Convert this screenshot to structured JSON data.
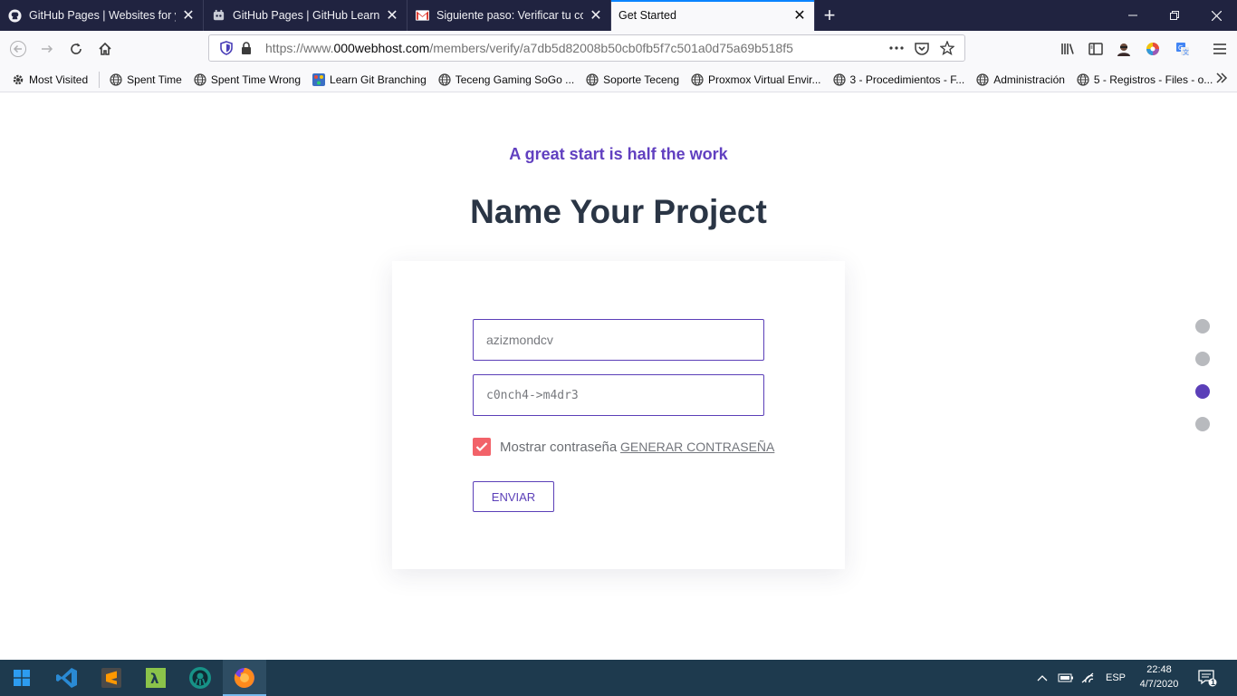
{
  "browser": {
    "tabs": [
      {
        "title": "GitHub Pages | Websites for you",
        "icon": "github-icon"
      },
      {
        "title": "GitHub Pages | GitHub Learning",
        "icon": "github-lab-icon"
      },
      {
        "title": "Siguiente paso: Verificar tu corr",
        "icon": "gmail-icon"
      },
      {
        "title": "Get Started",
        "icon": "none",
        "active": true
      }
    ],
    "url_prefix": "https://www.",
    "url_domain": "000webhost.com",
    "url_path": "/members/verify/a7db5d82008b50cb0fb5f7c501a0d75a69b518f5",
    "bookmarks": [
      {
        "label": "Most Visited",
        "icon": "gear-icon"
      },
      {
        "label": "Spent Time",
        "icon": "globe-icon"
      },
      {
        "label": "Spent Time Wrong",
        "icon": "globe-icon"
      },
      {
        "label": "Learn Git Branching",
        "icon": "git-branch-icon"
      },
      {
        "label": "Teceng Gaming SoGo ...",
        "icon": "globe-icon"
      },
      {
        "label": "Soporte Teceng",
        "icon": "globe-icon"
      },
      {
        "label": "Proxmox Virtual Envir...",
        "icon": "globe-icon"
      },
      {
        "label": "3 - Procedimientos - F...",
        "icon": "globe-icon"
      },
      {
        "label": "Administración",
        "icon": "globe-icon"
      },
      {
        "label": "5 - Registros - Files - o...",
        "icon": "globe-icon"
      }
    ]
  },
  "page": {
    "tagline": "A great start is half the work",
    "title": "Name Your Project",
    "form": {
      "project_name_value": "azizmondcv",
      "password_value": "c0nch4->m4dr3",
      "show_password_label": "Mostrar contraseña",
      "show_password_checked": true,
      "generate_password_label": "GENERAR CONTRASEÑA",
      "submit_label": "ENVIAR"
    },
    "steps": {
      "total": 4,
      "current": 3
    },
    "colors": {
      "accent": "#5b3fb8",
      "checkbox": "#f26269",
      "title": "#2a3545"
    }
  },
  "taskbar": {
    "language": "ESP",
    "time": "22:48",
    "date": "4/7/2020",
    "notification_count": "1"
  }
}
